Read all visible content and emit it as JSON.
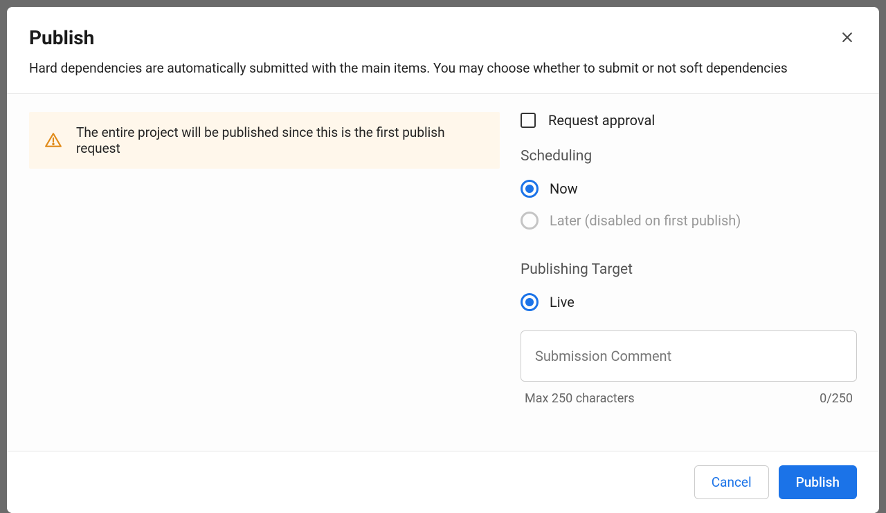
{
  "modal": {
    "title": "Publish",
    "subtitle": "Hard dependencies are automatically submitted with the main items. You may choose whether to submit or not soft dependencies"
  },
  "alert": {
    "text": "The entire project will be published since this is the first publish request"
  },
  "form": {
    "request_approval_label": "Request approval",
    "scheduling_heading": "Scheduling",
    "scheduling_now": "Now",
    "scheduling_later": "Later (disabled on first publish)",
    "target_heading": "Publishing Target",
    "target_live": "Live",
    "comment_placeholder": "Submission Comment",
    "comment_hint": "Max 250 characters",
    "comment_counter": "0/250"
  },
  "footer": {
    "cancel": "Cancel",
    "publish": "Publish"
  }
}
